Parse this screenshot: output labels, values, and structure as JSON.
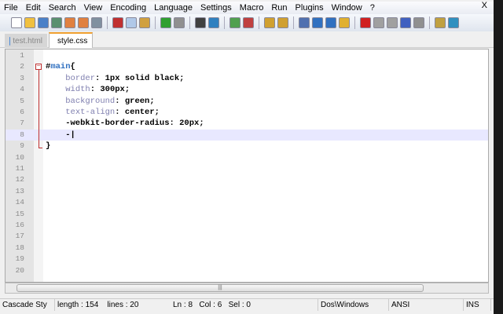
{
  "menu": [
    "File",
    "Edit",
    "Search",
    "View",
    "Encoding",
    "Language",
    "Settings",
    "Macro",
    "Run",
    "Plugins",
    "Window",
    "?"
  ],
  "close_label": "X",
  "tabs": [
    {
      "label": "test.html",
      "color": "#4a8ad8"
    },
    {
      "label": "style.css",
      "color": "#d84040"
    }
  ],
  "lines": [
    {
      "n": "1",
      "html": ""
    },
    {
      "n": "2",
      "html": "#<span class='sel'>main</span>{"
    },
    {
      "n": "3",
      "html": "    <span class='prop'>border</span>: 1px solid black;"
    },
    {
      "n": "4",
      "html": "    <span class='prop'>width</span>: 300px;"
    },
    {
      "n": "5",
      "html": "    <span class='prop'>background</span>: green;"
    },
    {
      "n": "6",
      "html": "    <span class='prop'>text-align</span>: center;"
    },
    {
      "n": "7",
      "html": "    -webkit-border-radius: 20px;"
    },
    {
      "n": "8",
      "html": "    -|"
    },
    {
      "n": "9",
      "html": "}"
    },
    {
      "n": "10",
      "html": ""
    },
    {
      "n": "11",
      "html": ""
    },
    {
      "n": "12",
      "html": ""
    },
    {
      "n": "13",
      "html": ""
    },
    {
      "n": "14",
      "html": ""
    },
    {
      "n": "15",
      "html": ""
    },
    {
      "n": "16",
      "html": ""
    },
    {
      "n": "17",
      "html": ""
    },
    {
      "n": "18",
      "html": ""
    },
    {
      "n": "19",
      "html": ""
    },
    {
      "n": "20",
      "html": ""
    }
  ],
  "status": {
    "lang": "Cascade Sty",
    "length": "length : 154",
    "lines": "lines : 20",
    "ln": "Ln : 8",
    "col": "Col : 6",
    "sel": "Sel : 0",
    "eol": "Dos\\Windows",
    "enc": "ANSI",
    "mode": "INS"
  },
  "toolbar": [
    [
      "new-icon",
      "#fff"
    ],
    [
      "open-icon",
      "#f0c040"
    ],
    [
      "save-icon",
      "#4a80c8"
    ],
    [
      "save-all-icon",
      "#5a9070"
    ],
    [
      "close-icon",
      "#e08040"
    ],
    [
      "close-all-icon",
      "#e08040"
    ],
    [
      "print-icon",
      "#8090a0"
    ],
    [
      "sep",
      ""
    ],
    [
      "cut-icon",
      "#c03030"
    ],
    [
      "copy-icon",
      "#b0c8e8"
    ],
    [
      "paste-icon",
      "#d0a040"
    ],
    [
      "sep",
      ""
    ],
    [
      "undo-icon",
      "#30a030"
    ],
    [
      "redo-icon",
      "#909090"
    ],
    [
      "sep",
      ""
    ],
    [
      "find-icon",
      "#404040"
    ],
    [
      "replace-icon",
      "#3080c0"
    ],
    [
      "sep",
      ""
    ],
    [
      "zoom-in-icon",
      "#50a050"
    ],
    [
      "zoom-out-icon",
      "#c04040"
    ],
    [
      "sep",
      ""
    ],
    [
      "sync-v-icon",
      "#d0a030"
    ],
    [
      "sync-h-icon",
      "#d0a030"
    ],
    [
      "sep",
      ""
    ],
    [
      "wrap-icon",
      "#5070b0"
    ],
    [
      "all-chars-icon",
      "#3070c0"
    ],
    [
      "indent-guide-icon",
      "#3070c0"
    ],
    [
      "doc-map-icon",
      "#e0b030"
    ],
    [
      "sep",
      ""
    ],
    [
      "record-icon",
      "#d02020"
    ],
    [
      "stop-icon",
      "#a0a0a0"
    ],
    [
      "play-icon",
      "#a0a0a0"
    ],
    [
      "play-multi-icon",
      "#4060c0"
    ],
    [
      "save-macro-icon",
      "#909090"
    ],
    [
      "sep",
      ""
    ],
    [
      "folder-icon",
      "#c0a040"
    ],
    [
      "spellcheck-icon",
      "#3090c0"
    ]
  ]
}
